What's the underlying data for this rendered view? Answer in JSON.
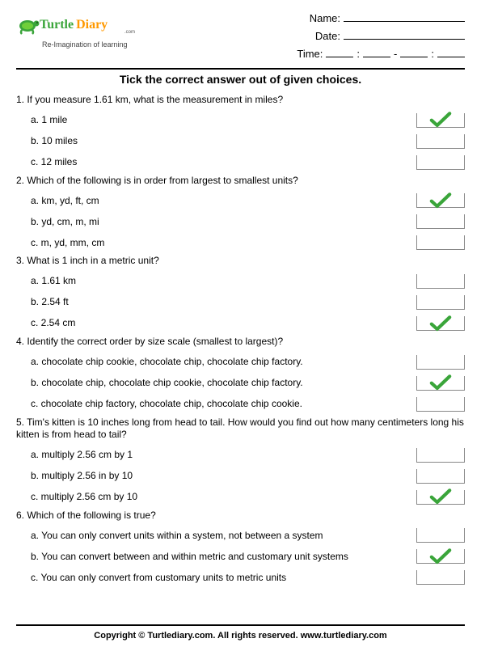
{
  "header": {
    "tagline": "Re-Imagination of learning",
    "name_label": "Name:",
    "date_label": "Date:",
    "time_label": "Time:",
    "colon": ":",
    "dash": "-"
  },
  "instruction": "Tick the correct answer out of given choices.",
  "questions": [
    {
      "num": "1.",
      "text": "If you measure 1.61 km, what is the measurement in miles?",
      "opts": [
        {
          "label": "a. 1 mile",
          "correct": true
        },
        {
          "label": "b. 10 miles",
          "correct": false
        },
        {
          "label": "c. 12 miles",
          "correct": false
        }
      ]
    },
    {
      "num": "2.",
      "text": "Which of the following is in order from largest to smallest units?",
      "opts": [
        {
          "label": "a. km, yd, ft, cm",
          "correct": true
        },
        {
          "label": "b. yd, cm, m, mi",
          "correct": false
        },
        {
          "label": "c. m, yd, mm, cm",
          "correct": false
        }
      ]
    },
    {
      "num": "3.",
      "text": "What is 1 inch in a metric unit?",
      "opts": [
        {
          "label": "a. 1.61 km",
          "correct": false
        },
        {
          "label": "b. 2.54 ft",
          "correct": false
        },
        {
          "label": "c. 2.54 cm",
          "correct": true
        }
      ]
    },
    {
      "num": "4.",
      "text": "Identify the correct order by size scale (smallest to largest)?",
      "opts": [
        {
          "label": "a. chocolate chip cookie, chocolate chip, chocolate chip factory.",
          "correct": false
        },
        {
          "label": "b. chocolate chip, chocolate chip cookie, chocolate chip factory.",
          "correct": true
        },
        {
          "label": "c. chocolate chip factory, chocolate chip, chocolate chip cookie.",
          "correct": false
        }
      ]
    },
    {
      "num": "5.",
      "text": "Tim's kitten is 10 inches long from head to tail. How would you find out how many centimeters long his kitten is from head to tail?",
      "opts": [
        {
          "label": "a. multiply 2.56 cm by 1",
          "correct": false
        },
        {
          "label": "b. multiply 2.56 in by 10",
          "correct": false
        },
        {
          "label": "c. multiply 2.56 cm by 10",
          "correct": true
        }
      ]
    },
    {
      "num": "6.",
      "text": "Which of the following is true?",
      "opts": [
        {
          "label": "a. You can only convert units within a system, not between a system",
          "correct": false
        },
        {
          "label": "b. You can convert between and within metric and customary unit systems",
          "correct": true
        },
        {
          "label": "c. You can only convert from customary units to metric units",
          "correct": false
        }
      ]
    }
  ],
  "footer": "Copyright © Turtlediary.com. All rights reserved. www.turtlediary.com"
}
